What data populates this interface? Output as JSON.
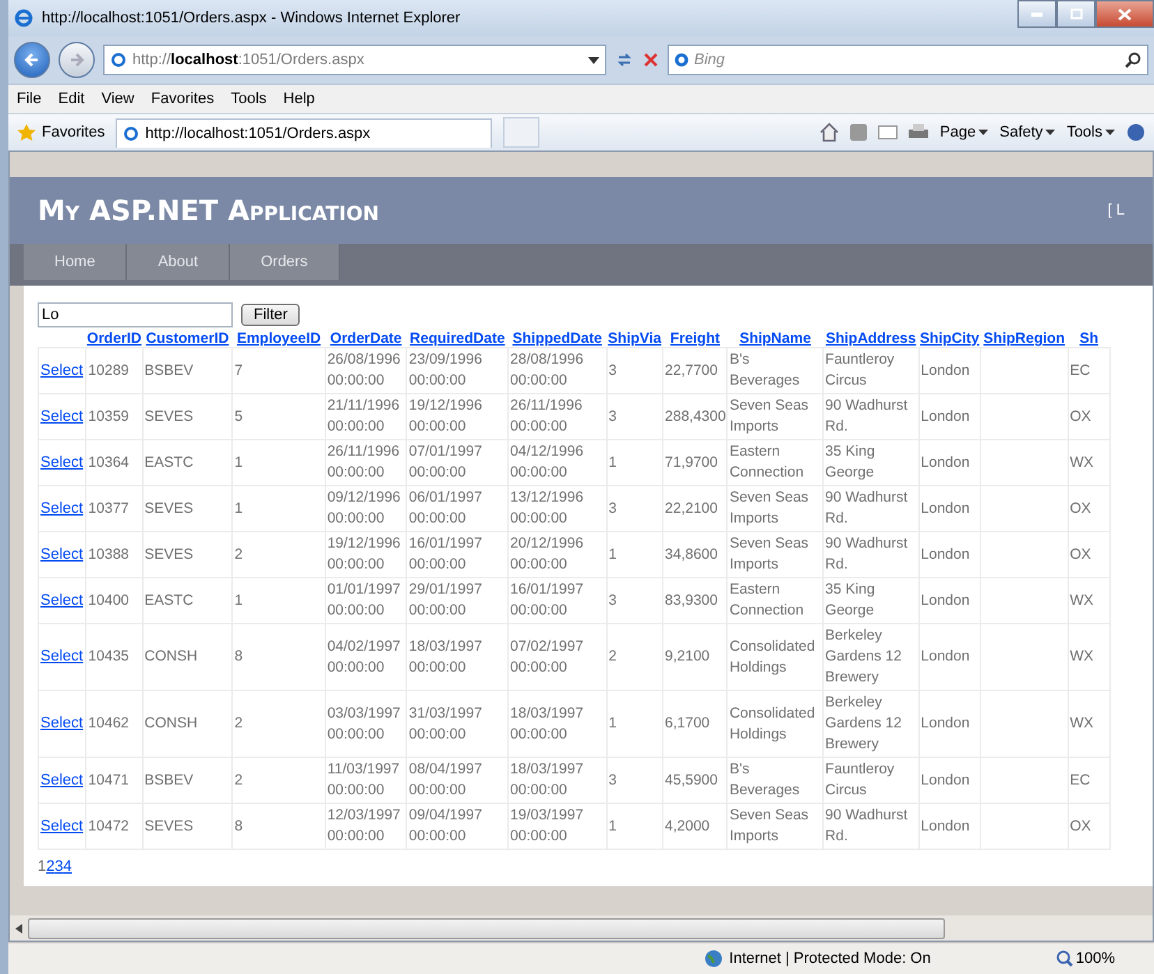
{
  "window": {
    "title": "http://localhost:1051/Orders.aspx - Windows Internet Explorer"
  },
  "address_bar": {
    "prefix": "http://",
    "host": "localhost",
    "suffix": ":1051/Orders.aspx"
  },
  "search": {
    "placeholder": "Bing"
  },
  "menu": [
    "File",
    "Edit",
    "View",
    "Favorites",
    "Tools",
    "Help"
  ],
  "favorites_bar": {
    "label": "Favorites",
    "tab_title": "http://localhost:1051/Orders.aspx",
    "commands": [
      "Page",
      "Safety",
      "Tools"
    ]
  },
  "site": {
    "title": "My ASP.NET Application",
    "login_link": "[ L",
    "nav": [
      {
        "label": "Home",
        "selected": false
      },
      {
        "label": "About",
        "selected": false
      },
      {
        "label": "Orders",
        "selected": false
      }
    ]
  },
  "filter": {
    "value": "Lo",
    "button": "Filter"
  },
  "table": {
    "columns": [
      "OrderID",
      "CustomerID",
      "EmployeeID",
      "OrderDate",
      "RequiredDate",
      "ShippedDate",
      "ShipVia",
      "Freight",
      "ShipName",
      "ShipAddress",
      "ShipCity",
      "ShipRegion",
      "Sh"
    ],
    "select_labels": [
      "Select",
      "Select",
      "Select",
      "Select",
      "Select",
      "Select",
      "Select",
      "Select",
      "Select",
      "Select"
    ],
    "rows": [
      [
        "10289",
        "BSBEV",
        "7",
        "26/08/1996 00:00:00",
        "23/09/1996 00:00:00",
        "28/08/1996 00:00:00",
        "3",
        "22,7700",
        "B's Beverages",
        "Fauntleroy Circus",
        "London",
        "",
        "EC"
      ],
      [
        "10359",
        "SEVES",
        "5",
        "21/11/1996 00:00:00",
        "19/12/1996 00:00:00",
        "26/11/1996 00:00:00",
        "3",
        "288,4300",
        "Seven Seas Imports",
        "90 Wadhurst Rd.",
        "London",
        "",
        "OX"
      ],
      [
        "10364",
        "EASTC",
        "1",
        "26/11/1996 00:00:00",
        "07/01/1997 00:00:00",
        "04/12/1996 00:00:00",
        "1",
        "71,9700",
        "Eastern Connection",
        "35 King George",
        "London",
        "",
        "WX"
      ],
      [
        "10377",
        "SEVES",
        "1",
        "09/12/1996 00:00:00",
        "06/01/1997 00:00:00",
        "13/12/1996 00:00:00",
        "3",
        "22,2100",
        "Seven Seas Imports",
        "90 Wadhurst Rd.",
        "London",
        "",
        "OX"
      ],
      [
        "10388",
        "SEVES",
        "2",
        "19/12/1996 00:00:00",
        "16/01/1997 00:00:00",
        "20/12/1996 00:00:00",
        "1",
        "34,8600",
        "Seven Seas Imports",
        "90 Wadhurst Rd.",
        "London",
        "",
        "OX"
      ],
      [
        "10400",
        "EASTC",
        "1",
        "01/01/1997 00:00:00",
        "29/01/1997 00:00:00",
        "16/01/1997 00:00:00",
        "3",
        "83,9300",
        "Eastern Connection",
        "35 King George",
        "London",
        "",
        "WX"
      ],
      [
        "10435",
        "CONSH",
        "8",
        "04/02/1997 00:00:00",
        "18/03/1997 00:00:00",
        "07/02/1997 00:00:00",
        "2",
        "9,2100",
        "Consolidated Holdings",
        "Berkeley Gardens 12 Brewery",
        "London",
        "",
        "WX"
      ],
      [
        "10462",
        "CONSH",
        "2",
        "03/03/1997 00:00:00",
        "31/03/1997 00:00:00",
        "18/03/1997 00:00:00",
        "1",
        "6,1700",
        "Consolidated Holdings",
        "Berkeley Gardens 12 Brewery",
        "London",
        "",
        "WX"
      ],
      [
        "10471",
        "BSBEV",
        "2",
        "11/03/1997 00:00:00",
        "08/04/1997 00:00:00",
        "18/03/1997 00:00:00",
        "3",
        "45,5900",
        "B's Beverages",
        "Fauntleroy Circus",
        "London",
        "",
        "EC"
      ],
      [
        "10472",
        "SEVES",
        "8",
        "12/03/1997 00:00:00",
        "09/04/1997 00:00:00",
        "19/03/1997 00:00:00",
        "1",
        "4,2000",
        "Seven Seas Imports",
        "90 Wadhurst Rd.",
        "London",
        "",
        "OX"
      ]
    ]
  },
  "pager": [
    {
      "label": "1",
      "selected": true
    },
    {
      "label": "2",
      "selected": false
    },
    {
      "label": "3",
      "selected": false
    },
    {
      "label": "4",
      "selected": false
    }
  ],
  "status_bar": {
    "zone": "Internet | Protected Mode: On",
    "zoom": "100%"
  }
}
